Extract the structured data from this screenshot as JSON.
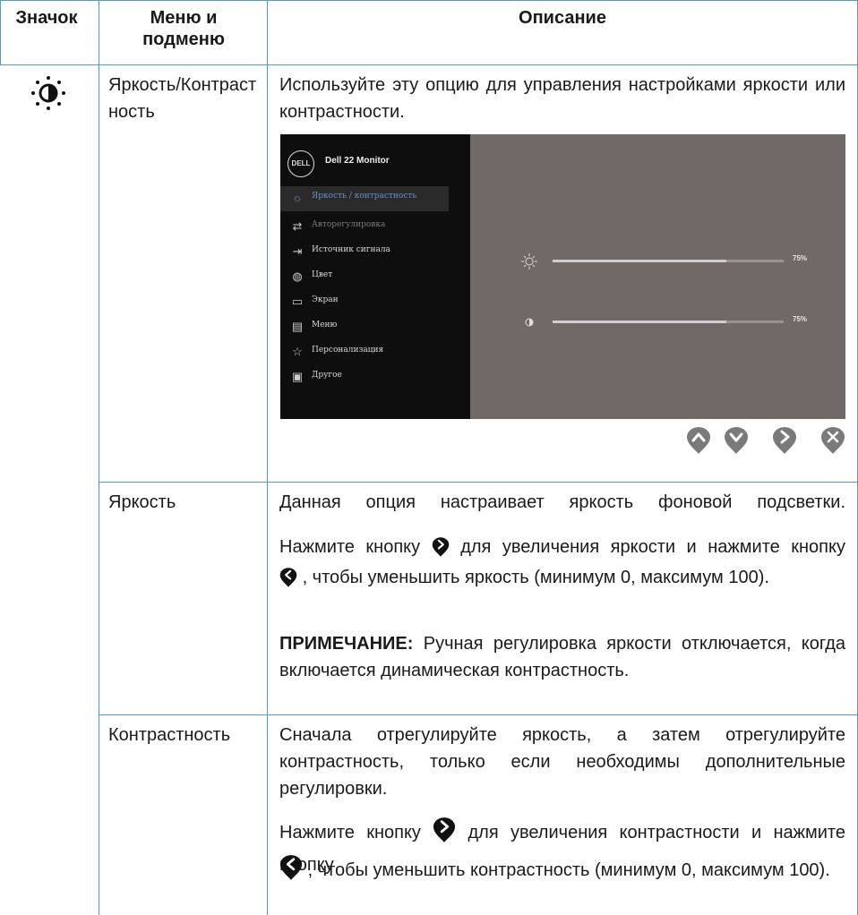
{
  "header": {
    "col_icon": "Значок",
    "col_menu": "Меню и подменю",
    "col_desc": "Описание"
  },
  "rows": [
    {
      "icon": "brightness-contrast-icon",
      "menu": "Яркость/Контрастность",
      "description": "Используйте эту опцию для управления настройками яркости или контрастности."
    },
    {
      "menu": "Яркость",
      "p1": "Данная опция настраивает яркость фоновой подсветки.",
      "p2a": "Нажмите кнопку",
      "p2b": "для увеличения яркости и нажмите кнопку",
      "p2c": ", чтобы уменьшить яркость (минимум 0, максимум 100).",
      "note_label": "ПРИМЕЧАНИЕ:",
      "note_text": "Ручная регулировка яркости отключается, когда включается динамическая контрастность."
    },
    {
      "menu": "Контрастность",
      "p1": "Сначала отрегулируйте яркость, а затем отрегулируйте контрастность, только если необходимы дополнительные регулировки.",
      "p2a": "Нажмите кнопку",
      "p2b": "для увеличения контрастности и нажмите кнопку",
      "p2c": ", чтобы уменьшить контрастность (минимум 0, максимум 100)."
    }
  ],
  "osd": {
    "logo": "DELL",
    "title": "Dell 22 Monitor",
    "menu_items": [
      {
        "label": "Яркость / контрастность",
        "icon": "brightness-icon",
        "state": "active"
      },
      {
        "label": "Авторегулировка",
        "icon": "auto-adjust-icon",
        "state": "dim"
      },
      {
        "label": "Источник сигнала",
        "icon": "input-source-icon",
        "state": "normal"
      },
      {
        "label": "Цвет",
        "icon": "color-icon",
        "state": "normal"
      },
      {
        "label": "Экран",
        "icon": "display-icon",
        "state": "normal"
      },
      {
        "label": "Меню",
        "icon": "menu-icon",
        "state": "normal"
      },
      {
        "label": "Персонализация",
        "icon": "star-icon",
        "state": "normal"
      },
      {
        "label": "Другое",
        "icon": "others-icon",
        "state": "normal"
      }
    ],
    "brightness": {
      "value": 0.75,
      "label": "75%"
    },
    "contrast": {
      "value": 0.75,
      "label": "75%"
    },
    "nav_buttons": [
      "up-button-icon",
      "down-button-icon",
      "right-button-icon",
      "exit-button-icon"
    ]
  },
  "colors": {
    "grid": "#6a93ad",
    "osd_bg": "#706966",
    "osd_menu": "#0e0e0e",
    "button": "#7a7a7a"
  }
}
